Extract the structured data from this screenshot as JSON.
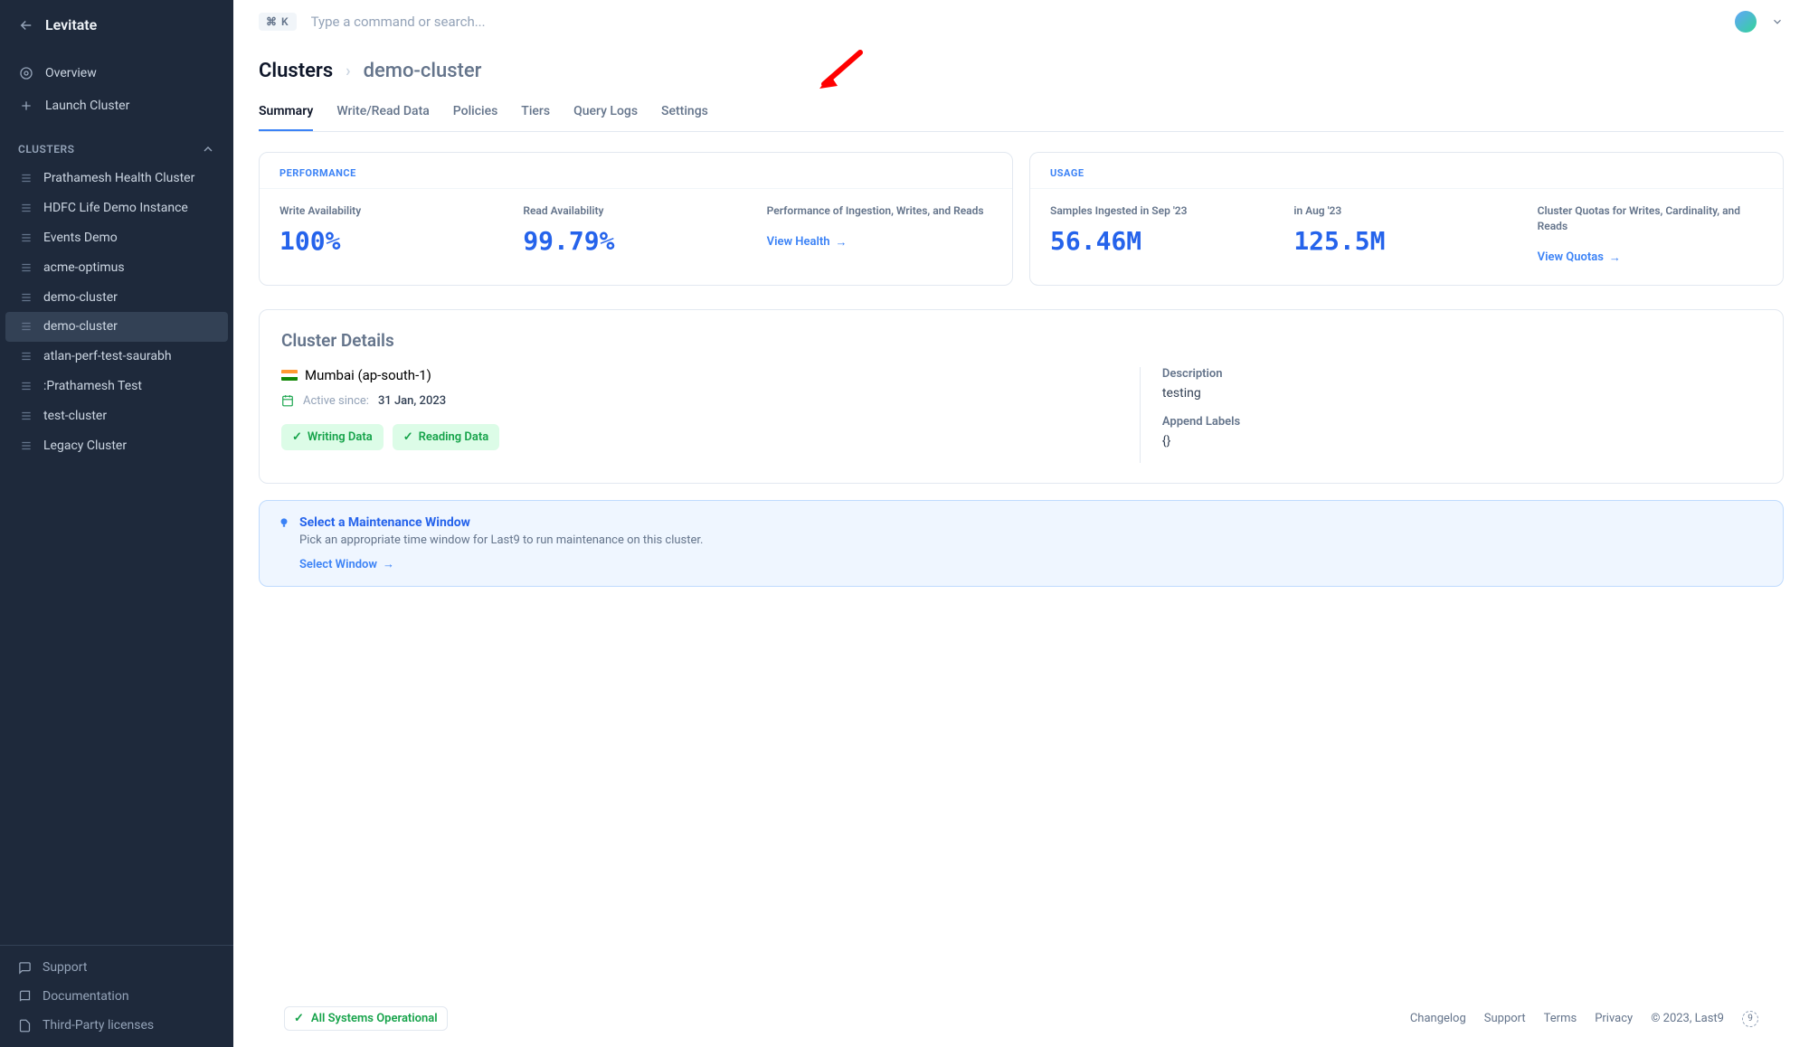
{
  "brand": "Levitate",
  "search": {
    "placeholder": "Type a command or search...",
    "kbd": "⌘  K"
  },
  "nav": {
    "overview": "Overview",
    "launch": "Launch Cluster"
  },
  "clusters_header": "CLUSTERS",
  "clusters": [
    {
      "label": "Prathamesh Health Cluster"
    },
    {
      "label": "HDFC Life Demo Instance"
    },
    {
      "label": "Events Demo"
    },
    {
      "label": "acme-optimus"
    },
    {
      "label": "demo-cluster"
    },
    {
      "label": "demo-cluster"
    },
    {
      "label": "atlan-perf-test-saurabh"
    },
    {
      "label": ":Prathamesh Test"
    },
    {
      "label": "test-cluster"
    },
    {
      "label": "Legacy Cluster"
    }
  ],
  "footer_links": {
    "support": "Support",
    "docs": "Documentation",
    "licenses": "Third-Party licenses"
  },
  "breadcrumb": {
    "root": "Clusters",
    "current": "demo-cluster"
  },
  "tabs": [
    "Summary",
    "Write/Read Data",
    "Policies",
    "Tiers",
    "Query Logs",
    "Settings"
  ],
  "perf_card": {
    "title": "PERFORMANCE",
    "write": {
      "label": "Write Availability",
      "value": "100%"
    },
    "read": {
      "label": "Read Availability",
      "value": "99.79%"
    },
    "health": {
      "label": "Performance of Ingestion, Writes, and Reads",
      "link": "View Health"
    }
  },
  "usage_card": {
    "title": "USAGE",
    "sep": {
      "label": "Samples Ingested in Sep '23",
      "value": "56.46M"
    },
    "aug": {
      "label": "in Aug '23",
      "value": "125.5M"
    },
    "quotas": {
      "label": "Cluster Quotas for Writes, Cardinality, and Reads",
      "link": "View Quotas"
    }
  },
  "details": {
    "title": "Cluster Details",
    "region": "Mumbai (ap-south-1)",
    "active_label": "Active since:",
    "active_date": "31 Jan, 2023",
    "writing": "Writing Data",
    "reading": "Reading Data",
    "desc_label": "Description",
    "desc_value": "testing",
    "labels_label": "Append Labels",
    "labels_value": "{}"
  },
  "maint": {
    "title": "Select a Maintenance Window",
    "text": "Pick an appropriate time window for Last9 to run maintenance on this cluster.",
    "link": "Select Window"
  },
  "bottom": {
    "ops": "All Systems Operational",
    "links": [
      "Changelog",
      "Support",
      "Terms",
      "Privacy"
    ],
    "copyright": "© 2023, Last9"
  }
}
